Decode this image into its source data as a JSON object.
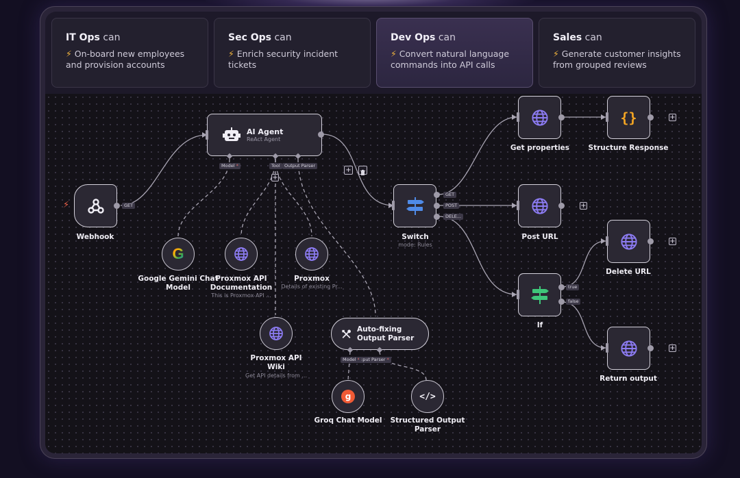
{
  "cards": [
    {
      "team": "IT Ops",
      "can": "can",
      "desc": "On-board new employees and provision accounts"
    },
    {
      "team": "Sec Ops",
      "can": "can",
      "desc": "Enrich security incident tickets"
    },
    {
      "team": "Dev Ops",
      "can": "can",
      "desc": "Convert natural language commands into API calls"
    },
    {
      "team": "Sales",
      "can": "can",
      "desc": "Generate customer insights from grouped reviews"
    }
  ],
  "active_card": "Dev Ops",
  "bolt_icon": "⚡",
  "nodes": {
    "webhook": {
      "label": "Webhook",
      "port": "GET"
    },
    "ai_agent": {
      "title": "AI Agent",
      "subtitle": "ReAct Agent",
      "model_tag": "Model",
      "tool_tag": "Tool",
      "parser_tag": "Output Parser"
    },
    "gemini": {
      "label": "Google Gemini Chat Model"
    },
    "proxmox_doc": {
      "label": "Proxmox API Documentation",
      "sub": "This is Proxmox API ..."
    },
    "proxmox": {
      "label": "Proxmox",
      "sub": "Details of existing Pr..."
    },
    "proxmox_wiki": {
      "label": "Proxmox API Wiki",
      "sub": "Get API details from ..."
    },
    "autofix": {
      "title": "Auto-fixing Output Parser",
      "model_tag": "Model",
      "parser_tag": ":put Parser"
    },
    "groq": {
      "label": "Groq Chat Model"
    },
    "structured": {
      "label": "Structured Output Parser"
    },
    "switch": {
      "label": "Switch",
      "sub": "mode: Rules",
      "out_get": "GET",
      "out_post": "POST",
      "out_delete": "DELE..."
    },
    "get_props": {
      "label": "Get properties"
    },
    "structure_resp": {
      "label": "Structure Response"
    },
    "post_url": {
      "label": "Post URL"
    },
    "if_node": {
      "label": "If",
      "out_true": "true",
      "out_false": "false"
    },
    "delete_url": {
      "label": "Delete URL"
    },
    "return_output": {
      "label": "Return output"
    }
  },
  "colors": {
    "accent_purple": "#8d7cf4",
    "switch_blue": "#4f8be8",
    "if_green": "#3fc77a",
    "groq_orange": "#f05a35",
    "json_yellow": "#f5a623",
    "trigger_red": "#e8604a"
  }
}
